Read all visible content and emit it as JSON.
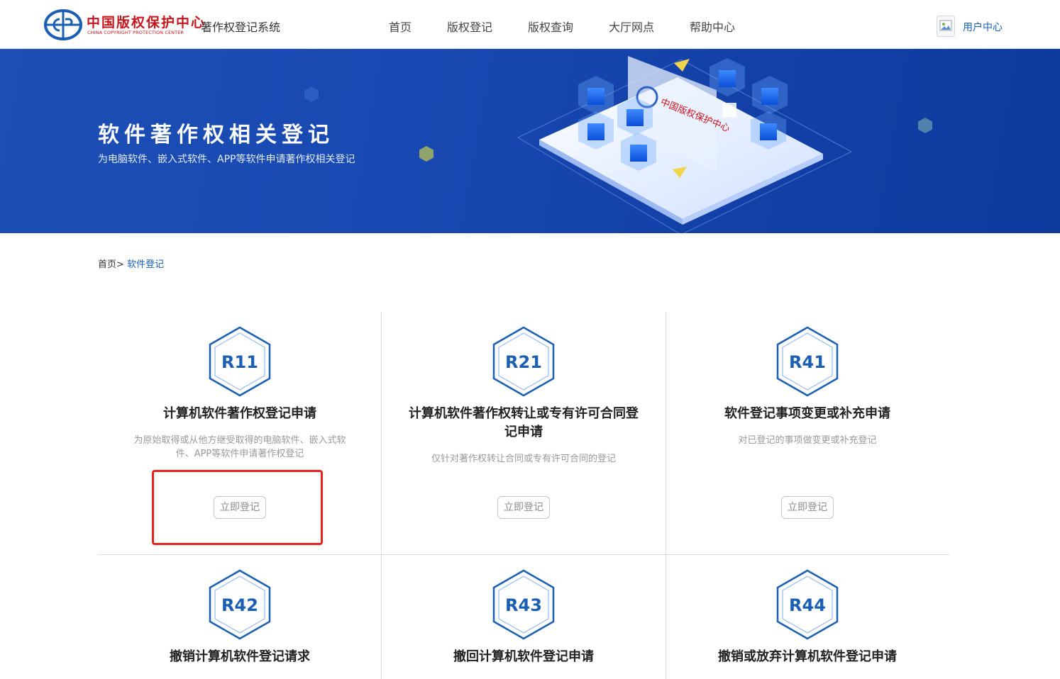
{
  "header": {
    "logo_cn": "中国版权保护中心",
    "logo_en": "CHINA COPYRIGHT PROTECTION CENTER",
    "system_title": "著作权登记系统",
    "nav": [
      "首页",
      "版权登记",
      "版权查询",
      "大厅网点",
      "帮助中心"
    ],
    "user_center": "用户中心"
  },
  "banner": {
    "title": "软件著作权相关登记",
    "subtitle": "为电脑软件、嵌入式软件、APP等软件申请著作权相关登记"
  },
  "breadcrumb": {
    "home": "首页",
    "separator": ">",
    "current": "软件登记"
  },
  "cards": [
    {
      "code": "R11",
      "title": "计算机软件著作权登记申请",
      "desc": "为原始取得或从他方继受取得的电脑软件、嵌入式软件、APP等软件申请著作权登记",
      "button": "立即登记"
    },
    {
      "code": "R21",
      "title": "计算机软件著作权转让或专有许可合同登记申请",
      "desc": "仅针对著作权转让合同或专有许可合同的登记",
      "button": "立即登记"
    },
    {
      "code": "R41",
      "title": "软件登记事项变更或补充申请",
      "desc": "对已登记的事项做变更或补充登记",
      "button": "立即登记"
    },
    {
      "code": "R42",
      "title": "撤销计算机软件登记请求"
    },
    {
      "code": "R43",
      "title": "撤回计算机软件登记申请"
    },
    {
      "code": "R44",
      "title": "撤销或放弃计算机软件登记申请"
    }
  ],
  "colors": {
    "accent": "#1a5fb4",
    "banner": "#1848b1",
    "logo_red": "#c8161d",
    "highlight": "#e8231e"
  }
}
